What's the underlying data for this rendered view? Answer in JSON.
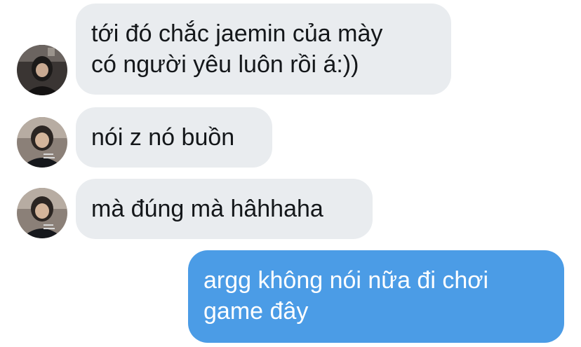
{
  "conversation": {
    "messages": [
      {
        "direction": "incoming",
        "lines": [
          "tới đó chắc jaemin của mày",
          "có người yêu luôn rồi á:))"
        ]
      },
      {
        "direction": "incoming",
        "lines": [
          "nói z nó buồn"
        ]
      },
      {
        "direction": "incoming",
        "lines": [
          "mà đúng mà hâhhaha"
        ]
      },
      {
        "direction": "outgoing",
        "lines": [
          "argg không nói nữa đi chơi",
          "game đây"
        ]
      }
    ]
  },
  "colors": {
    "incoming_bubble": "#e9ecef",
    "outgoing_bubble": "#4b9ce6",
    "incoming_text": "#14171a",
    "outgoing_text": "#ffffff"
  },
  "icons": {
    "sender_avatar": "avatar-photo"
  }
}
